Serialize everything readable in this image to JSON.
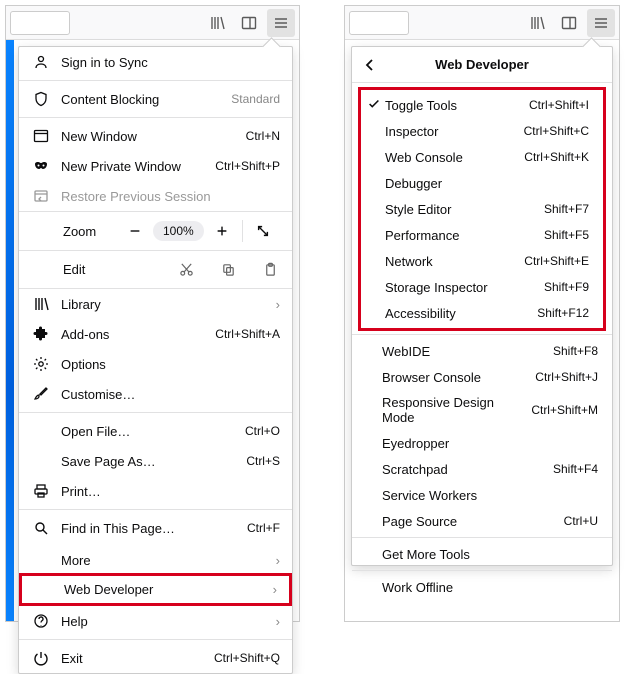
{
  "left": {
    "signin": "Sign in to Sync",
    "contentBlocking": {
      "label": "Content Blocking",
      "status": "Standard"
    },
    "newWindow": {
      "label": "New Window",
      "shortcut": "Ctrl+N"
    },
    "newPrivate": {
      "label": "New Private Window",
      "shortcut": "Ctrl+Shift+P"
    },
    "restore": "Restore Previous Session",
    "zoom": {
      "label": "Zoom",
      "value": "100%"
    },
    "edit": "Edit",
    "library": "Library",
    "addons": {
      "label": "Add-ons",
      "shortcut": "Ctrl+Shift+A"
    },
    "options": "Options",
    "customise": "Customise…",
    "openFile": {
      "label": "Open File…",
      "shortcut": "Ctrl+O"
    },
    "saveAs": {
      "label": "Save Page As…",
      "shortcut": "Ctrl+S"
    },
    "print": "Print…",
    "find": {
      "label": "Find in This Page…",
      "shortcut": "Ctrl+F"
    },
    "more": "More",
    "webdev": "Web Developer",
    "help": "Help",
    "exit": {
      "label": "Exit",
      "shortcut": "Ctrl+Shift+Q"
    }
  },
  "right": {
    "title": "Web Developer",
    "group1": [
      {
        "label": "Toggle Tools",
        "shortcut": "Ctrl+Shift+I",
        "checked": true
      },
      {
        "label": "Inspector",
        "shortcut": "Ctrl+Shift+C"
      },
      {
        "label": "Web Console",
        "shortcut": "Ctrl+Shift+K"
      },
      {
        "label": "Debugger",
        "shortcut": ""
      },
      {
        "label": "Style Editor",
        "shortcut": "Shift+F7"
      },
      {
        "label": "Performance",
        "shortcut": "Shift+F5"
      },
      {
        "label": "Network",
        "shortcut": "Ctrl+Shift+E"
      },
      {
        "label": "Storage Inspector",
        "shortcut": "Shift+F9"
      },
      {
        "label": "Accessibility",
        "shortcut": "Shift+F12"
      }
    ],
    "group2": [
      {
        "label": "WebIDE",
        "shortcut": "Shift+F8"
      },
      {
        "label": "Browser Console",
        "shortcut": "Ctrl+Shift+J"
      },
      {
        "label": "Responsive Design Mode",
        "shortcut": "Ctrl+Shift+M"
      },
      {
        "label": "Eyedropper",
        "shortcut": ""
      },
      {
        "label": "Scratchpad",
        "shortcut": "Shift+F4"
      },
      {
        "label": "Service Workers",
        "shortcut": ""
      },
      {
        "label": "Page Source",
        "shortcut": "Ctrl+U"
      }
    ],
    "getMore": "Get More Tools",
    "offline": "Work Offline"
  }
}
